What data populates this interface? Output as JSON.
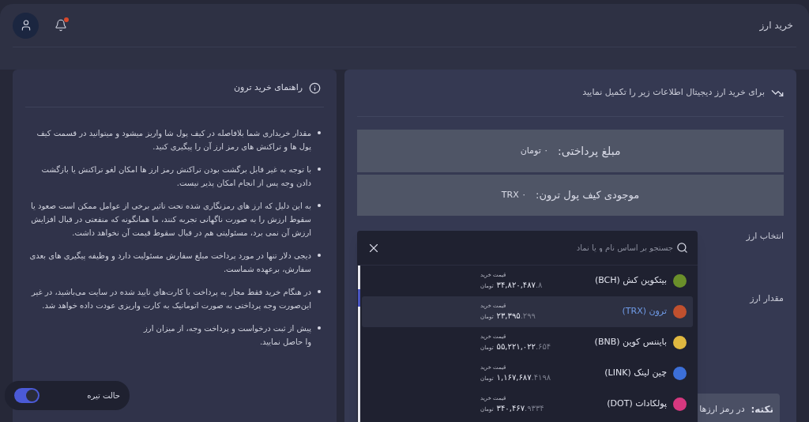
{
  "header": {
    "title": "خرید ارز",
    "notification_dot": true
  },
  "guide": {
    "title": "راهنمای خرید ترون",
    "items": [
      "مقدار خریداری شما بلافاصله در کیف پول شا واریز میشود و میتوانید در قسمت کیف پول ها و تراکنش های رمز ارز آن را پیگیری کنید.",
      "با توجه به غیر قابل برگشت بودن تراکنش رمز ارز ها امکان لغو تراکنش یا بازگشت دادن وجه پس از انجام امکان پذیر نیست.",
      "به این دلیل که ارز های رمزنگاری شده تحت تاثیر برخی از عوامل ممکن است صعود یا سقوط ارزش را به صورت ناگهانی تجربه کنند، ما همانگونه که منفعتی در قبال افزایش ارزش آن نمی برد، مسئولیتی هم در قبال سقوط قیمت آن نخواهد داشت.",
      "دیجی دلار تنها در مورد پرداخت مبلغ سفارش مسئولیت دارد و وظیفه پیگیری های بعدی سفارش، برعهده شماست.",
      "در هنگام خرید فقط مجاز به پرداخت با کارت‌های تایید شده در سایت می‌باشید، در غیر این‌صورت وجه پرداختی به صورت اتوماتیک به کارت واریزی عودت داده خواهد شد.",
      "پیش از ثبت درخواست و پرداخت وجه، از میزان ارز وا حاصل نمایید."
    ]
  },
  "form": {
    "intro": "برای خرید ارز دیجیتال اطلاعات زیر را تکمیل نمایید",
    "payment": {
      "label": "مبلغ پرداختی:",
      "value": "۰ تومان"
    },
    "wallet": {
      "label": "موجودی کیف پول ترون:",
      "value": "۰ TRX"
    },
    "fields": [
      "انتخاب ارز",
      "مقدار ارز"
    ],
    "note": {
      "label": "نکته:",
      "text": "در رمز ارزها"
    }
  },
  "dropdown": {
    "placeholder": "جستجو بر اساس نام و یا نماد",
    "items": [
      {
        "name": "بیتکوین کش (BCH)",
        "color": "#6a8f2a",
        "selected": false,
        "price_label": "قیمت خرید",
        "price": "۳۴,۸۲۰,۴۸۷",
        "decimals": ".۸",
        "unit": "تومان"
      },
      {
        "name": "ترون (TRX)",
        "color": "#c0502e",
        "selected": true,
        "price_label": "قیمت خرید",
        "price": "۲۳,۳۹۵",
        "decimals": ".۲۹۹",
        "unit": "تومان"
      },
      {
        "name": "بایننس کوین (BNB)",
        "color": "#e0b840",
        "selected": false,
        "price_label": "قیمت خرید",
        "price": "۵۵,۲۲۱,۰۲۲",
        "decimals": ".۶۵۴",
        "unit": "تومان"
      },
      {
        "name": "چین لینک (LINK)",
        "color": "#3c6fd8",
        "selected": false,
        "price_label": "قیمت خرید",
        "price": "۱,۱۶۷,۶۸۷",
        "decimals": ".۴۱۹۸",
        "unit": "تومان"
      },
      {
        "name": "پولکادات (DOT)",
        "color": "#d6387f",
        "selected": false,
        "price_label": "قیمت خرید",
        "price": "۳۴۰,۴۶۷",
        "decimals": ".۹۳۳۴",
        "unit": "تومان"
      }
    ]
  },
  "dark_mode": {
    "label": "حالت تیره",
    "on": true
  }
}
